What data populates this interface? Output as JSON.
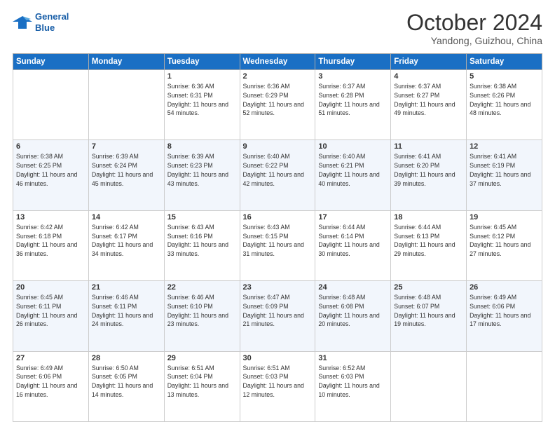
{
  "logo": {
    "line1": "General",
    "line2": "Blue"
  },
  "title": "October 2024",
  "location": "Yandong, Guizhou, China",
  "days_of_week": [
    "Sunday",
    "Monday",
    "Tuesday",
    "Wednesday",
    "Thursday",
    "Friday",
    "Saturday"
  ],
  "weeks": [
    [
      {
        "day": "",
        "detail": ""
      },
      {
        "day": "",
        "detail": ""
      },
      {
        "day": "1",
        "detail": "Sunrise: 6:36 AM\nSunset: 6:31 PM\nDaylight: 11 hours and 54 minutes."
      },
      {
        "day": "2",
        "detail": "Sunrise: 6:36 AM\nSunset: 6:29 PM\nDaylight: 11 hours and 52 minutes."
      },
      {
        "day": "3",
        "detail": "Sunrise: 6:37 AM\nSunset: 6:28 PM\nDaylight: 11 hours and 51 minutes."
      },
      {
        "day": "4",
        "detail": "Sunrise: 6:37 AM\nSunset: 6:27 PM\nDaylight: 11 hours and 49 minutes."
      },
      {
        "day": "5",
        "detail": "Sunrise: 6:38 AM\nSunset: 6:26 PM\nDaylight: 11 hours and 48 minutes."
      }
    ],
    [
      {
        "day": "6",
        "detail": "Sunrise: 6:38 AM\nSunset: 6:25 PM\nDaylight: 11 hours and 46 minutes."
      },
      {
        "day": "7",
        "detail": "Sunrise: 6:39 AM\nSunset: 6:24 PM\nDaylight: 11 hours and 45 minutes."
      },
      {
        "day": "8",
        "detail": "Sunrise: 6:39 AM\nSunset: 6:23 PM\nDaylight: 11 hours and 43 minutes."
      },
      {
        "day": "9",
        "detail": "Sunrise: 6:40 AM\nSunset: 6:22 PM\nDaylight: 11 hours and 42 minutes."
      },
      {
        "day": "10",
        "detail": "Sunrise: 6:40 AM\nSunset: 6:21 PM\nDaylight: 11 hours and 40 minutes."
      },
      {
        "day": "11",
        "detail": "Sunrise: 6:41 AM\nSunset: 6:20 PM\nDaylight: 11 hours and 39 minutes."
      },
      {
        "day": "12",
        "detail": "Sunrise: 6:41 AM\nSunset: 6:19 PM\nDaylight: 11 hours and 37 minutes."
      }
    ],
    [
      {
        "day": "13",
        "detail": "Sunrise: 6:42 AM\nSunset: 6:18 PM\nDaylight: 11 hours and 36 minutes."
      },
      {
        "day": "14",
        "detail": "Sunrise: 6:42 AM\nSunset: 6:17 PM\nDaylight: 11 hours and 34 minutes."
      },
      {
        "day": "15",
        "detail": "Sunrise: 6:43 AM\nSunset: 6:16 PM\nDaylight: 11 hours and 33 minutes."
      },
      {
        "day": "16",
        "detail": "Sunrise: 6:43 AM\nSunset: 6:15 PM\nDaylight: 11 hours and 31 minutes."
      },
      {
        "day": "17",
        "detail": "Sunrise: 6:44 AM\nSunset: 6:14 PM\nDaylight: 11 hours and 30 minutes."
      },
      {
        "day": "18",
        "detail": "Sunrise: 6:44 AM\nSunset: 6:13 PM\nDaylight: 11 hours and 29 minutes."
      },
      {
        "day": "19",
        "detail": "Sunrise: 6:45 AM\nSunset: 6:12 PM\nDaylight: 11 hours and 27 minutes."
      }
    ],
    [
      {
        "day": "20",
        "detail": "Sunrise: 6:45 AM\nSunset: 6:11 PM\nDaylight: 11 hours and 26 minutes."
      },
      {
        "day": "21",
        "detail": "Sunrise: 6:46 AM\nSunset: 6:11 PM\nDaylight: 11 hours and 24 minutes."
      },
      {
        "day": "22",
        "detail": "Sunrise: 6:46 AM\nSunset: 6:10 PM\nDaylight: 11 hours and 23 minutes."
      },
      {
        "day": "23",
        "detail": "Sunrise: 6:47 AM\nSunset: 6:09 PM\nDaylight: 11 hours and 21 minutes."
      },
      {
        "day": "24",
        "detail": "Sunrise: 6:48 AM\nSunset: 6:08 PM\nDaylight: 11 hours and 20 minutes."
      },
      {
        "day": "25",
        "detail": "Sunrise: 6:48 AM\nSunset: 6:07 PM\nDaylight: 11 hours and 19 minutes."
      },
      {
        "day": "26",
        "detail": "Sunrise: 6:49 AM\nSunset: 6:06 PM\nDaylight: 11 hours and 17 minutes."
      }
    ],
    [
      {
        "day": "27",
        "detail": "Sunrise: 6:49 AM\nSunset: 6:06 PM\nDaylight: 11 hours and 16 minutes."
      },
      {
        "day": "28",
        "detail": "Sunrise: 6:50 AM\nSunset: 6:05 PM\nDaylight: 11 hours and 14 minutes."
      },
      {
        "day": "29",
        "detail": "Sunrise: 6:51 AM\nSunset: 6:04 PM\nDaylight: 11 hours and 13 minutes."
      },
      {
        "day": "30",
        "detail": "Sunrise: 6:51 AM\nSunset: 6:03 PM\nDaylight: 11 hours and 12 minutes."
      },
      {
        "day": "31",
        "detail": "Sunrise: 6:52 AM\nSunset: 6:03 PM\nDaylight: 11 hours and 10 minutes."
      },
      {
        "day": "",
        "detail": ""
      },
      {
        "day": "",
        "detail": ""
      }
    ]
  ]
}
